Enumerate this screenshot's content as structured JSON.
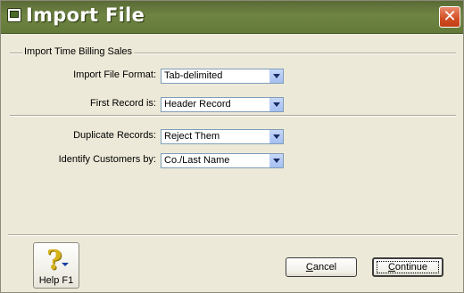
{
  "window": {
    "title": "Import File",
    "close_glyph": "✕"
  },
  "group": {
    "title": "Import Time Billing Sales"
  },
  "fields": [
    {
      "label": "Import File Format:",
      "value": "Tab-delimited"
    },
    {
      "label": "First Record is:",
      "value": "Header Record"
    },
    {
      "label": "Duplicate Records:",
      "value": "Reject Them"
    },
    {
      "label": "Identify Customers by:",
      "value": "Co./Last Name"
    }
  ],
  "buttons": {
    "help_label": "Help F1",
    "help_glyph": "?",
    "cancel_first": "C",
    "cancel_rest": "ancel",
    "continue_first": "C",
    "continue_rest": "ontinue"
  },
  "colors": {
    "title_bar": "#627a38",
    "close_button": "#d14d22",
    "dialog_bg": "#ece9d8",
    "help_icon": "#d6b21a"
  }
}
